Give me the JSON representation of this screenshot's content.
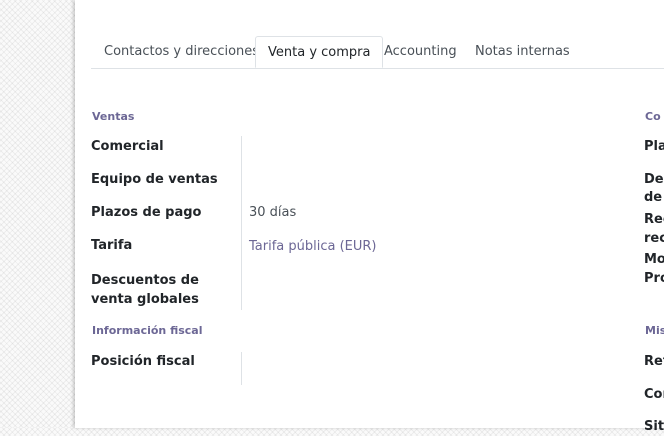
{
  "tabs": [
    {
      "label": "Contactos y direcciones"
    },
    {
      "label": "Venta y compra"
    },
    {
      "label": "Accounting"
    },
    {
      "label": "Notas internas"
    }
  ],
  "left": {
    "section_sales": "Ventas",
    "comercial_label": "Comercial",
    "comercial_value": "",
    "equipo_label": "Equipo de ventas",
    "equipo_value": "",
    "plazos_label": "Plazos de pago",
    "plazos_value": "30 días",
    "tarifa_label": "Tarifa",
    "tarifa_value": "Tarifa pública (EUR)",
    "descuentos_label": "Descuentos de venta globales",
    "descuentos_value": "",
    "section_fiscal": "Información fiscal",
    "posicion_label": "Posición fiscal",
    "posicion_value": ""
  },
  "right_cut": {
    "section1": "Co",
    "pla": "Pla",
    "des": "Des",
    "dec": "de c",
    "rec": "Rec",
    "rec2": "rec",
    "mon": "Mon",
    "pro": "Pro",
    "section2": "Mis",
    "ref": "Ref",
    "cor": "Cor",
    "siti": "Siti"
  }
}
